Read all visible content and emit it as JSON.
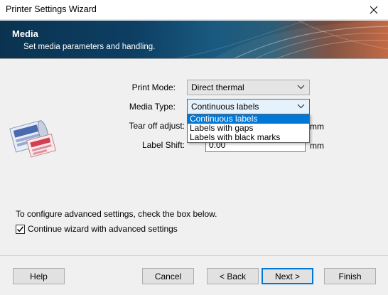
{
  "window": {
    "title": "Printer Settings Wizard",
    "close_icon": "close-icon"
  },
  "banner": {
    "title": "Media",
    "subtitle": "Set media parameters and handling."
  },
  "form": {
    "print_mode_label": "Print Mode:",
    "print_mode_value": "Direct thermal",
    "media_type_label": "Media Type:",
    "media_type_value": "Continuous labels",
    "tear_off_label": "Tear off adjust:",
    "tear_off_unit": "mm",
    "label_shift_label": "Label Shift:",
    "label_shift_value": "0.00",
    "label_shift_unit": "mm"
  },
  "media_type_options": [
    "Continuous labels",
    "Labels with gaps",
    "Labels with black marks"
  ],
  "advanced": {
    "info_text": "To configure advanced settings, check the box below.",
    "checkbox_label": "Continue wizard with advanced settings",
    "checked": true
  },
  "buttons": {
    "help": "Help",
    "cancel": "Cancel",
    "back": "< Back",
    "next": "Next >",
    "finish": "Finish"
  },
  "colors": {
    "accent": "#0078d7",
    "banner_dark": "#0d3f63",
    "banner_warm": "#c0603a"
  }
}
